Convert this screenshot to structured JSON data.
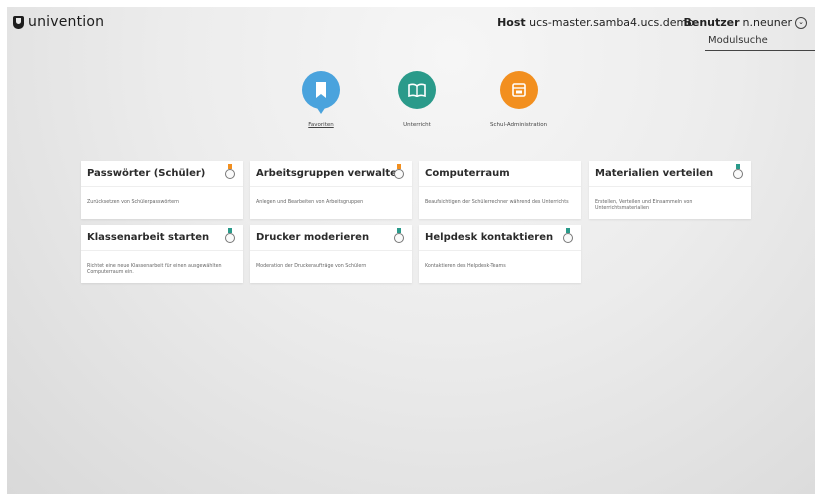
{
  "header": {
    "brand": "univention",
    "host_label": "Host",
    "host_value": "ucs-master.samba4.ucs.demo",
    "user_label": "Benutzer",
    "user_value": "n.neuner",
    "search_placeholder": "Modulsuche"
  },
  "categories": [
    {
      "label": "Favoriten",
      "color": "#4aa3dd",
      "icon": "bookmark-icon",
      "active": true
    },
    {
      "label": "Unterricht",
      "color": "#2a9a8a",
      "icon": "book-icon",
      "active": false
    },
    {
      "label": "Schul-Administration",
      "color": "#f28f1f",
      "icon": "school-admin-icon",
      "active": false
    }
  ],
  "tiles": [
    {
      "title": "Passwörter (Schüler)",
      "description": "Zurücksetzen von Schülerpasswörtern",
      "ribbon_color": "#f28f1f"
    },
    {
      "title": "Arbeitsgruppen verwalten",
      "description": "Anlegen und Bearbeiten von Arbeitsgruppen",
      "ribbon_color": "#f28f1f"
    },
    {
      "title": "Computerraum",
      "description": "Beaufsichtigen der Schülerrechner während des Unterrichts",
      "ribbon_color": "#2a9a8a"
    },
    {
      "title": "Materialien verteilen",
      "description": "Erstellen, Verteilen und Einsammeln von Unterrichtsmaterialien",
      "ribbon_color": "#2a9a8a"
    },
    {
      "title": "Klassenarbeit starten",
      "description": "Richtet eine neue Klassenarbeit für einen ausgewählten Computerraum ein.",
      "ribbon_color": "#2a9a8a"
    },
    {
      "title": "Drucker moderieren",
      "description": "Moderation der Druckeraufträge von Schülern",
      "ribbon_color": "#2a9a8a"
    },
    {
      "title": "Helpdesk kontaktieren",
      "description": "Kontaktieren des Helpdesk-Teams",
      "ribbon_color": "#2a9a8a"
    }
  ]
}
